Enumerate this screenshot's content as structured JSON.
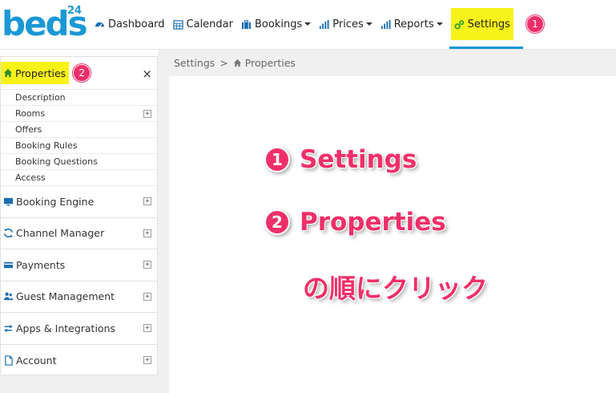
{
  "logo": {
    "word": "beds",
    "num": "24"
  },
  "nav": {
    "dashboard": "Dashboard",
    "calendar": "Calendar",
    "bookings": "Bookings",
    "prices": "Prices",
    "reports": "Reports",
    "settings": "Settings",
    "settings_badge": "1"
  },
  "breadcrumb": {
    "parent": "Settings",
    "sep": ">",
    "current": "Properties"
  },
  "sidebar": {
    "title": "Properties",
    "title_badge": "2",
    "close": "×",
    "sub_items": [
      "Description",
      "Rooms",
      "Offers",
      "Booking Rules",
      "Booking Questions",
      "Access"
    ],
    "sections": [
      "Booking Engine",
      "Channel Manager",
      "Payments",
      "Guest Management",
      "Apps & Integrations",
      "Account"
    ]
  },
  "annotations": {
    "step1_num": "1",
    "step1_text": "Settings",
    "step2_num": "2",
    "step2_text": "Properties",
    "step3_text": "の順にクリック"
  },
  "colors": {
    "brand": "#1a98d5",
    "highlight": "#f6f21a",
    "badge": "#ef2f6a"
  }
}
